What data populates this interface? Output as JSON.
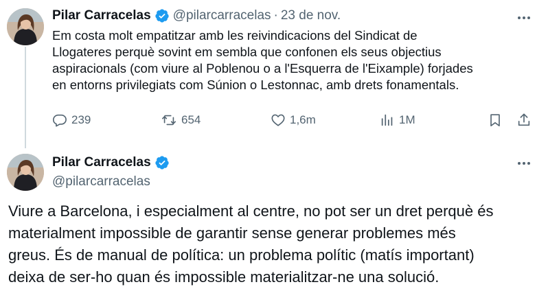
{
  "tweet1": {
    "author_name": "Pilar Carracelas",
    "author_handle": "@pilarcarracelas",
    "separator": "·",
    "date": "23 de nov.",
    "text": "Em costa molt empatitzar amb les reivindicacions del Sindicat de\nLlogateres perquè sovint em sembla que confonen els seus objectius\naspiracionals (com viure al Poblenou o a l'Esquerra de l'Eixample) forjades\nen entorns privilegiats com Súnion o Lestonnac, amb drets fonamentals.",
    "replies": "239",
    "reposts": "654",
    "likes": "1,6m",
    "views": "1M",
    "icons": [
      "reply-icon",
      "repost-icon",
      "like-icon",
      "views-icon",
      "bookmark-icon",
      "share-icon",
      "verified-badge-icon",
      "more-icon"
    ]
  },
  "tweet2": {
    "author_name": "Pilar Carracelas",
    "author_handle": "@pilarcarracelas",
    "text": "Viure a Barcelona, i especialment al centre, no pot ser un dret perquè és\nmaterialment impossible de garantir sense generar problemes més\ngreus. És de manual de política: un problema polític (matís important)\ndeixa de ser-ho quan és impossible materialitzar-ne una solució."
  },
  "colors": {
    "text": "#0f1419",
    "secondary": "#536471",
    "verified": "#1d9bf0",
    "thread_line": "#cfd9de"
  }
}
